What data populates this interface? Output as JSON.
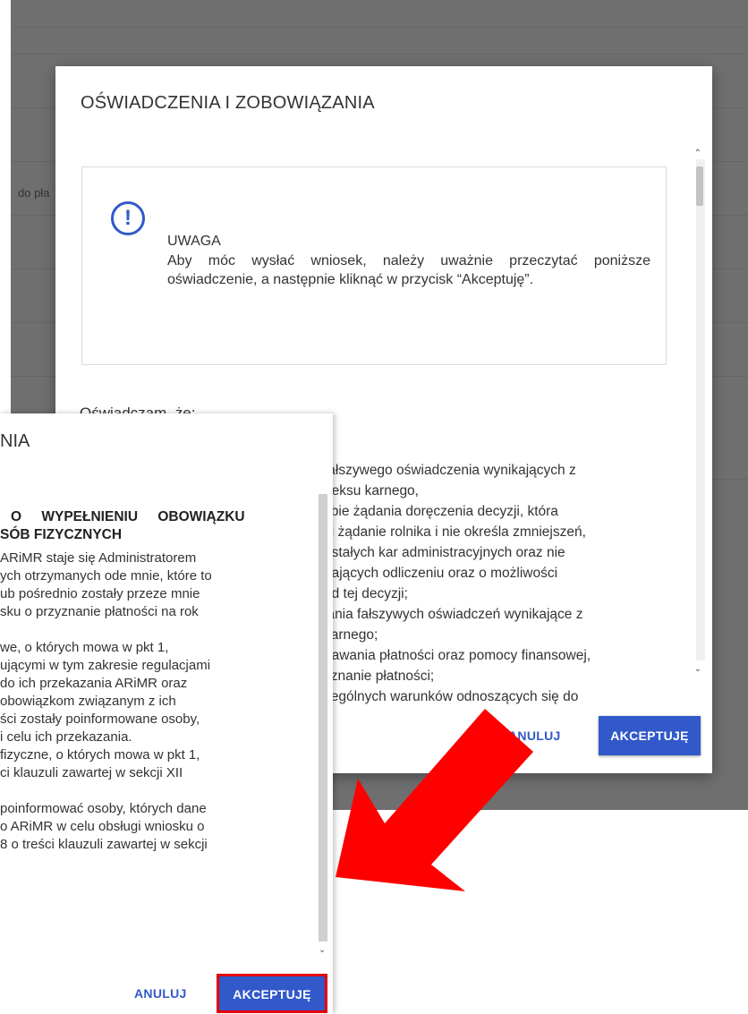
{
  "background": {
    "partial_label": "do pła"
  },
  "dialog_main": {
    "title": "OŚWIADCZENIA I ZOBOWIĄZANIA",
    "notice": {
      "icon": "exclamation-circle-icon",
      "title": "UWAGA",
      "text": "Aby móc wysłać wniosek, należy uważnie przeczytać poniższe oświadczenie, a następnie kliknąć w przycisk “Akceptuję”."
    },
    "declaration_label": "Oświadczam, że:",
    "visible_lines": [
      "fałszywego oświadczenia wynikających z",
      "deksu karnego,",
      "ybie żądania doręczenia decyzji, która",
      "ci żądanie rolnika i nie określa zmniejszeń,",
      "ostałych kar administracyjnych oraz nie",
      "gających odliczeniu oraz o możliwości",
      "od tej decyzji;",
      "lania fałszywych oświadczeń wynikające z",
      "karnego;",
      "nawania płatności oraz pomocy finansowej,",
      "yznanie płatności;",
      "zególnych warunków odnoszących się do"
    ],
    "cancel_label": "ANULUJ",
    "accept_label": "AKCEPTUJĘ"
  },
  "dialog_front": {
    "title_fragment": "NIA",
    "heading_lines": [
      "O WYPEŁNIENIU OBOWIĄZKU",
      "SÓB FIZYCZNYCH"
    ],
    "body_lines": [
      "ARiMR staje się Administratorem",
      "ych otrzymanych ode mnie, które to",
      "ub pośrednio zostały przeze mnie",
      "sku o przyznanie płatności na rok",
      "",
      "we, o których mowa w pkt 1,",
      "ującymi w tym zakresie regulacjami",
      " do ich przekazania ARiMR oraz",
      " obowiązkom związanym z ich",
      "ści zostały poinformowane osoby,",
      " i celu ich przekazania.",
      " fizyczne, o których mowa w pkt 1,",
      "ci klauzuli zawartej w sekcji XII",
      "",
      "poinformować osoby, których dane",
      "o ARiMR w celu obsługi wniosku o",
      "8 o treści klauzuli zawartej w sekcji"
    ],
    "cancel_label": "ANULUJ",
    "accept_label": "AKCEPTUJĘ"
  },
  "colors": {
    "primary": "#3159c9",
    "highlight": "#e60000",
    "overlay": "#6f6f6f"
  }
}
